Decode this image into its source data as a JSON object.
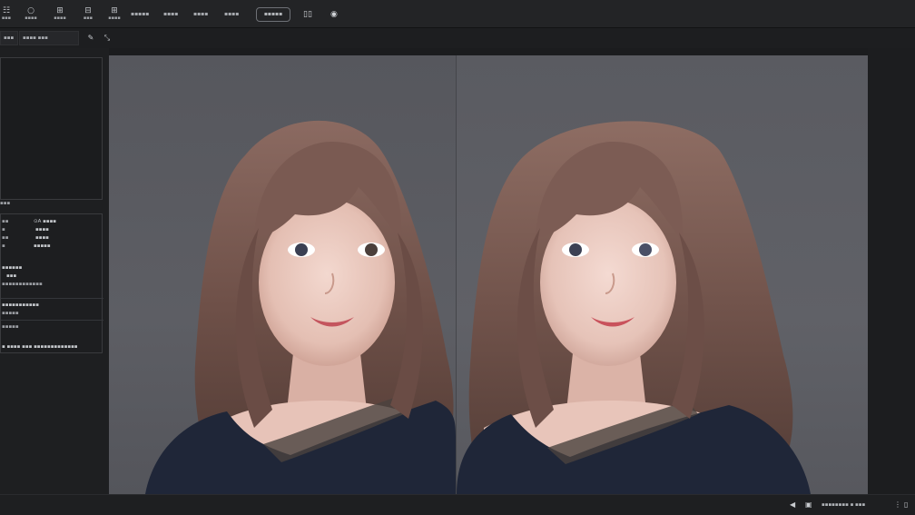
{
  "toolbar": {
    "buttons": [
      {
        "icon": "☷",
        "label": "▪▪▪"
      },
      {
        "icon": "○",
        "label": "▪▪▪▪"
      },
      {
        "icon": "⊞",
        "label": "▪▪▪▪"
      },
      {
        "icon": "⊟",
        "label": "▪▪▪"
      },
      {
        "icon": "⊞",
        "label": "▪▪▪▪"
      }
    ],
    "text_items": [
      "▪▪▪▪▪",
      "▪▪▪▪",
      "▪▪▪▪",
      "▪▪▪▪"
    ],
    "pill_label": "▪▪▪▪▪",
    "panel_icon": "▯▯",
    "settings_icon": "◉"
  },
  "subbar": {
    "field1": "▪▪▪",
    "field2": "▪▪▪▪ ▪▪▪",
    "tool_icon": "✎",
    "tool2_icon": "⤡"
  },
  "left_panel": {
    "section_title": "▪▪▪",
    "info_lines": [
      {
        "left": "▪▪",
        "right": "⊙A ▪▪▪▪"
      },
      {
        "left": "▪",
        "right": "▪▪▪▪"
      },
      {
        "left": "▪▪",
        "right": "▪▪▪▪"
      },
      {
        "left": "▪",
        "right": "▪▪▪▪▪"
      }
    ],
    "info_lines2": [
      "▪▪▪▪▪▪",
      "▪▪▪",
      "▪▪▪▪▪▪▪▪▪▪▪▪"
    ],
    "info_lines3": [
      "▪▪▪▪▪▪▪▪▪▪▪",
      "▪▪▪▪▪"
    ],
    "info_lines4": [
      "▪▪▪▪▪",
      "▪ ▪▪▪▪ ▪▪▪ ▪▪▪▪▪▪▪▪▪▪▪▪▪"
    ]
  },
  "statusbar": {
    "prev_icon": "◀",
    "view_icon": "▣",
    "status_text": "▪▪▪▪▪▪▪▪ ▪ ▪▪▪",
    "menu_icon": "⋮",
    "end_icon": "▯"
  },
  "colors": {
    "background": "#1b1c1e",
    "canvas_bg": "#5b5c62",
    "hair": "#6d5048",
    "sweater": "#1f2638",
    "skin": "#e9c9bf"
  }
}
